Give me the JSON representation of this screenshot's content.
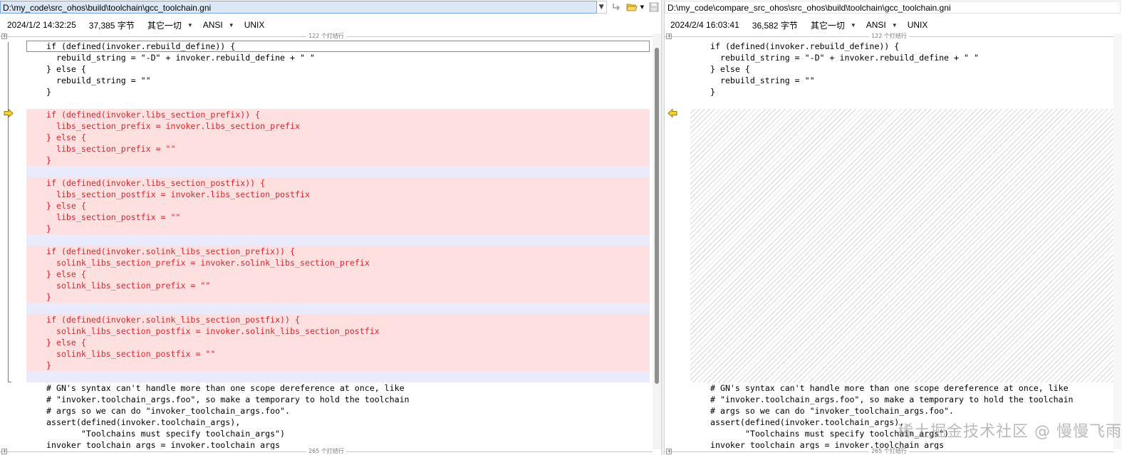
{
  "left": {
    "path": "D:\\my_code\\src_ohos\\build\\toolchain\\gcc_toolchain.gni",
    "timestamp": "2024/1/2 14:32:25",
    "size": "37,385 字节",
    "mode": "其它一切",
    "encoding": "ANSI",
    "line_ending": "UNIX",
    "top_fold": "122 个打结行",
    "bottom_fold": "265 个打结行",
    "lines": [
      "if (defined(invoker.rebuild_define)) {",
      "  rebuild_string = \"-D\" + invoker.rebuild_define + \" \"",
      "} else {",
      "  rebuild_string = \"\"",
      "}",
      "",
      "if (defined(invoker.libs_section_prefix)) {",
      "  libs_section_prefix = invoker.libs_section_prefix",
      "} else {",
      "  libs_section_prefix = \"\"",
      "}",
      "",
      "if (defined(invoker.libs_section_postfix)) {",
      "  libs_section_postfix = invoker.libs_section_postfix",
      "} else {",
      "  libs_section_postfix = \"\"",
      "}",
      "",
      "if (defined(invoker.solink_libs_section_prefix)) {",
      "  solink_libs_section_prefix = invoker.solink_libs_section_prefix",
      "} else {",
      "  solink_libs_section_prefix = \"\"",
      "}",
      "",
      "if (defined(invoker.solink_libs_section_postfix)) {",
      "  solink_libs_section_postfix = invoker.solink_libs_section_postfix",
      "} else {",
      "  solink_libs_section_postfix = \"\"",
      "}",
      "",
      "# GN's syntax can't handle more than one scope dereference at once, like",
      "# \"invoker.toolchain_args.foo\", so make a temporary to hold the toolchain",
      "# args so we can do \"invoker_toolchain_args.foo\".",
      "assert(defined(invoker.toolchain_args),",
      "       \"Toolchains must specify toolchain_args\")",
      "invoker_toolchain_args = invoker.toolchain_args"
    ]
  },
  "right": {
    "path": "D:\\my_code\\compare_src_ohos\\src_ohos\\build\\toolchain\\gcc_toolchain.gni",
    "timestamp": "2024/2/4 16:03:41",
    "size": "36,582 字节",
    "mode": "其它一切",
    "encoding": "ANSI",
    "line_ending": "UNIX",
    "top_fold": "122 个打结行",
    "bottom_fold": "265 个打结行",
    "lines_top": [
      "if (defined(invoker.rebuild_define)) {",
      "  rebuild_string = \"-D\" + invoker.rebuild_define + \" \"",
      "} else {",
      "  rebuild_string = \"\"",
      "}",
      ""
    ],
    "lines_bottom": [
      "# GN's syntax can't handle more than one scope dereference at once, like",
      "# \"invoker.toolchain_args.foo\", so make a temporary to hold the toolchain",
      "# args so we can do \"invoker_toolchain_args.foo\".",
      "assert(defined(invoker.toolchain_args),",
      "       \"Toolchains must specify toolchain_args\")",
      "invoker_toolchain_args = invoker.toolchain_args"
    ]
  },
  "toolbar": {
    "dropdown_icon": "chevron-down-icon",
    "swap_icon": "swap-icon",
    "open_icon": "folder-open-icon",
    "save_icon": "save-icon"
  },
  "watermark": "稀土掘金技术社区 @ 慢慢飞雨",
  "colors": {
    "diff_bg": "#ffe0e0",
    "diff_text": "#e0232b",
    "sep_bg": "#e9eafc",
    "path_active_bg": "#dde8f6"
  }
}
